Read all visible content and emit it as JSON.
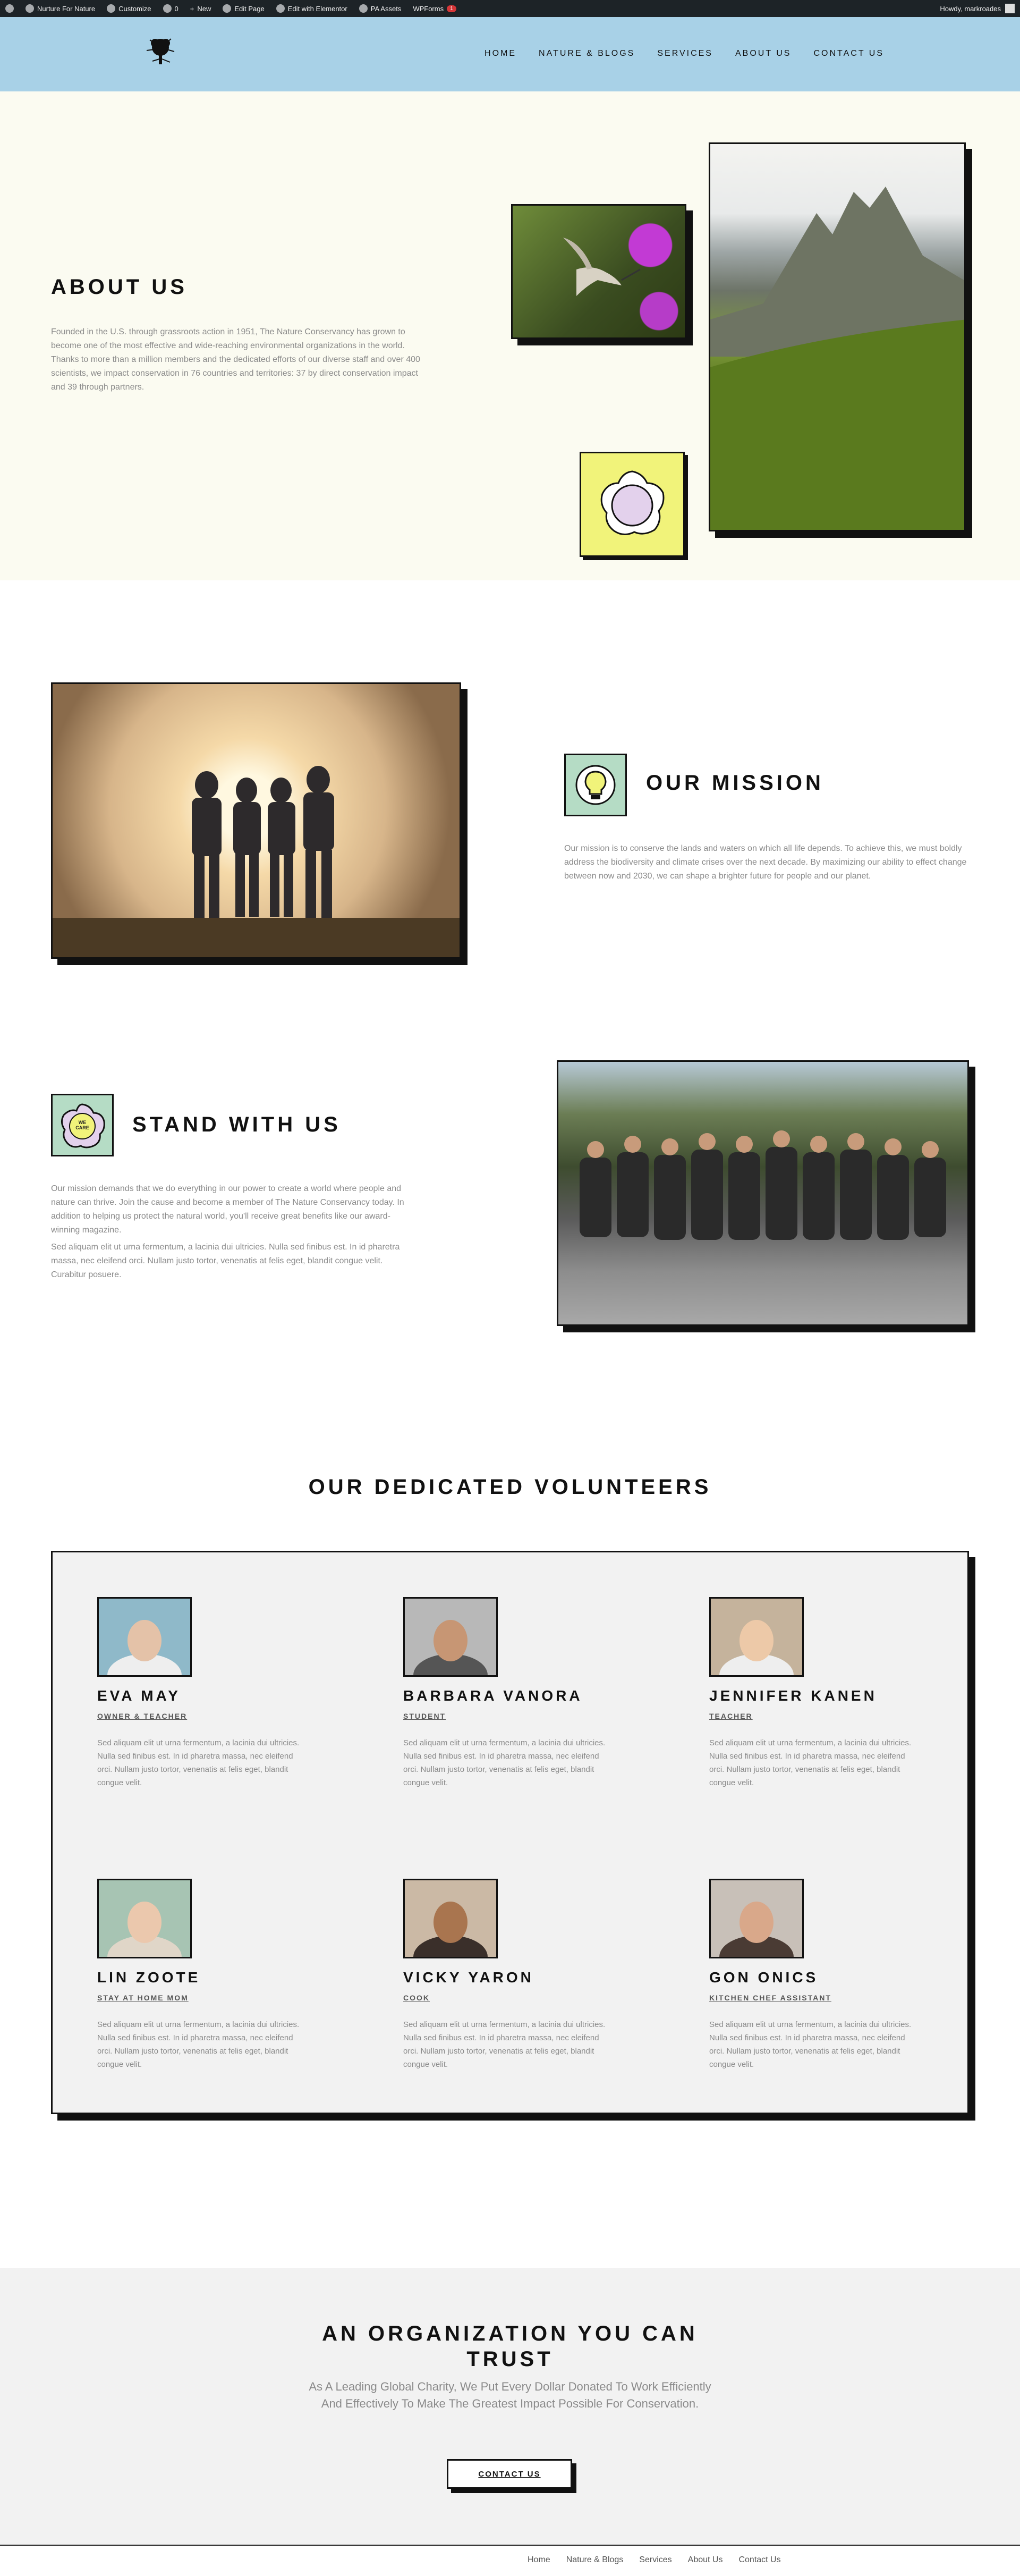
{
  "admin_bar": {
    "site_name": "Nurture For Nature",
    "customize": "Customize",
    "comments": "0",
    "new": "New",
    "edit_page": "Edit Page",
    "edit_elementor": "Edit with Elementor",
    "pa_assets": "PA Assets",
    "wpforms": "WPForms",
    "wpforms_badge": "1",
    "howdy": "Howdy, markroades"
  },
  "nav": {
    "items": [
      "HOME",
      "NATURE & BLOGS",
      "SERVICES",
      "ABOUT US",
      "CONTACT US"
    ]
  },
  "about": {
    "title": "ABOUT US",
    "text": "Founded in the U.S. through grassroots action in 1951, The Nature Conservancy has grown to become one of the most effective and wide-reaching environmental organizations in the world. Thanks to more than a million members and the dedicated efforts of our diverse staff and over 400 scientists, we impact conservation in 76 countries and territories: 37 by direct conservation impact and 39 through partners."
  },
  "mission": {
    "title": "OUR MISSION",
    "text": "Our mission is to conserve the lands and waters on which all life depends. To achieve this, we must boldly address the biodiversity and climate crises over the next decade. By maximizing our ability to effect change between now and 2030, we can shape a brighter future for people and our planet."
  },
  "stand": {
    "title": "STAND WITH US",
    "icon_text": "WE CARE",
    "text1": "Our mission demands that we do everything in our power to create a world where people and nature can thrive. Join the cause and become a member of The Nature Conservancy today. In addition to helping us protect the natural world, you'll receive great benefits like our award-winning magazine.",
    "text2": "Sed aliquam elit ut urna fermentum, a lacinia dui ultricies. Nulla sed finibus est. In id pharetra massa, nec eleifend orci. Nullam justo tortor, venenatis at felis eget, blandit congue velit. Curabitur posuere."
  },
  "volunteers": {
    "title": "OUR DEDICATED VOLUNTEERS",
    "members": [
      {
        "name": "EVA MAY",
        "role": "OWNER & TEACHER",
        "bio": "Sed aliquam elit ut urna fermentum, a lacinia dui ultricies. Nulla sed finibus est. In id pharetra massa, nec eleifend orci. Nullam justo tortor, venenatis at felis eget, blandit congue velit."
      },
      {
        "name": "BARBARA VANORA",
        "role": "STUDENT",
        "bio": "Sed aliquam elit ut urna fermentum, a lacinia dui ultricies. Nulla sed finibus est. In id pharetra massa, nec eleifend orci. Nullam justo tortor, venenatis at felis eget, blandit congue velit."
      },
      {
        "name": "JENNIFER KANEN",
        "role": "TEACHER",
        "bio": "Sed aliquam elit ut urna fermentum, a lacinia dui ultricies. Nulla sed finibus est. In id pharetra massa, nec eleifend orci. Nullam justo tortor, venenatis at felis eget, blandit congue velit."
      },
      {
        "name": "LIN ZOOTE",
        "role": "STAY AT HOME MOM",
        "bio": "Sed aliquam elit ut urna fermentum, a lacinia dui ultricies. Nulla sed finibus est. In id pharetra massa, nec eleifend orci. Nullam justo tortor, venenatis at felis eget, blandit congue velit."
      },
      {
        "name": "VICKY YARON",
        "role": "COOK",
        "bio": "Sed aliquam elit ut urna fermentum, a lacinia dui ultricies. Nulla sed finibus est. In id pharetra massa, nec eleifend orci. Nullam justo tortor, venenatis at felis eget, blandit congue velit."
      },
      {
        "name": "GON ONICS",
        "role": "KITCHEN CHEF ASSISTANT",
        "bio": "Sed aliquam elit ut urna fermentum, a lacinia dui ultricies. Nulla sed finibus est. In id pharetra massa, nec eleifend orci. Nullam justo tortor, venenatis at felis eget, blandit congue velit."
      }
    ]
  },
  "org": {
    "title": "AN ORGANIZATION YOU CAN TRUST",
    "subtitle": "As A Leading Global Charity, We Put Every Dollar Donated To Work Efficiently And Effectively To Make The Greatest Impact Possible For Conservation.",
    "button": "CONTACT US"
  },
  "footer": {
    "items": [
      "Home",
      "Nature & Blogs",
      "Services",
      "About Us",
      "Contact Us"
    ]
  },
  "colors": {
    "header_bg": "#a8d1e7",
    "about_bg": "#fbfbf1",
    "icon_bg": "#b5dcc5",
    "flower_bg": "#f1f37a",
    "card_bg": "#f2f2f2"
  }
}
